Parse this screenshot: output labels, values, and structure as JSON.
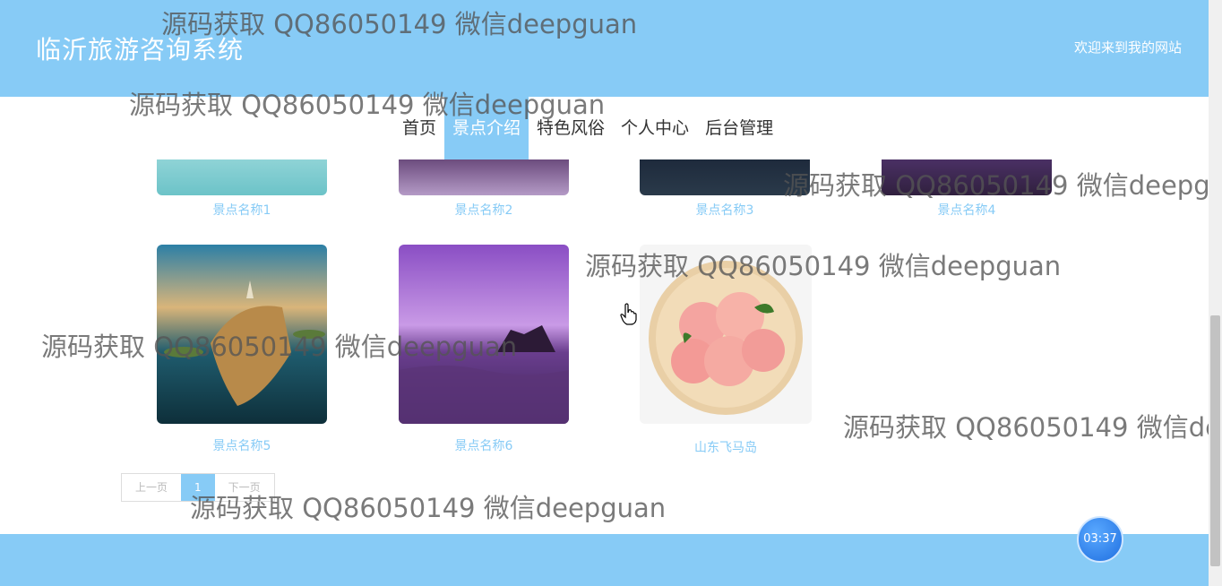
{
  "header": {
    "site_title": "临沂旅游咨询系统",
    "welcome": "欢迎来到我的网站"
  },
  "nav": {
    "items": [
      "首页",
      "景点介绍",
      "特色风俗",
      "个人中心",
      "后台管理"
    ],
    "active_index": 1
  },
  "spots_row1": [
    "景点名称1",
    "景点名称2",
    "景点名称3",
    "景点名称4"
  ],
  "spots_row2": [
    "景点名称5",
    "景点名称6",
    "山东飞马岛"
  ],
  "pager": {
    "prev": "上一页",
    "current": "1",
    "next": "下一页"
  },
  "timer": "03:37",
  "watermark": "源码获取 QQ86050149 微信deepguan",
  "colors": {
    "accent": "#87cbf6"
  }
}
